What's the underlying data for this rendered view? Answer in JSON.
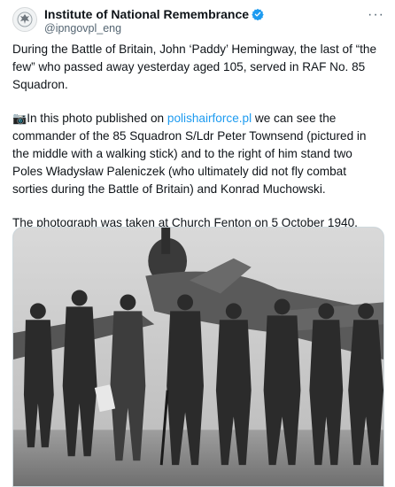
{
  "account": {
    "name": "Institute of National Remembrance",
    "handle": "@ipngovpl_eng",
    "avatar_icon": "eagle-emblem-icon",
    "verified_icon": "verified-badge-icon",
    "verified_color": "#1d9bf0"
  },
  "more_icon": "more-options-icon",
  "post": {
    "paragraph1": "During the Battle of Britain, John ‘Paddy’ Hemingway, the last of “the few” who passed away yesterday aged 105, served in RAF No. 85 Squadron.",
    "camera_icon": "camera-icon",
    "p2_before": "In this photo published on ",
    "p2_link": "polishairforce.pl",
    "p2_after": " we can see the commander of the 85 Squadron S/Ldr Peter Townsend (pictured in the middle with a walking stick) and to the right of him stand two Poles Władysław Paleniczek (who ultimately did not fly combat sorties during the Battle of Britain) and Konrad Muchowski.",
    "paragraph3": "The photograph was taken at Church Fenton on 5 October 1940."
  },
  "colors": {
    "text": "#0f1419",
    "secondary": "#536471",
    "link": "#1d9bf0"
  }
}
